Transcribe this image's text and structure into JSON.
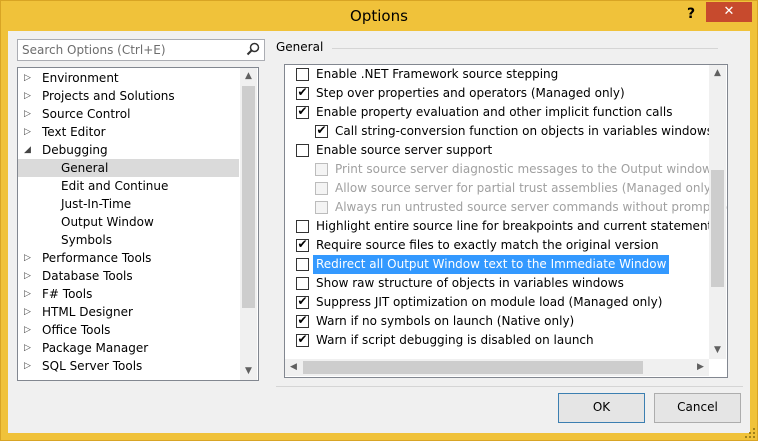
{
  "window": {
    "title": "Options",
    "help_label": "?",
    "close_label": "✕"
  },
  "search": {
    "placeholder": "Search Options (Ctrl+E)"
  },
  "tree": [
    {
      "label": "Environment",
      "level": 0,
      "expandable": true
    },
    {
      "label": "Projects and Solutions",
      "level": 0,
      "expandable": true
    },
    {
      "label": "Source Control",
      "level": 0,
      "expandable": true
    },
    {
      "label": "Text Editor",
      "level": 0,
      "expandable": true
    },
    {
      "label": "Debugging",
      "level": 0,
      "expanded": true
    },
    {
      "label": "General",
      "level": 1,
      "selected": true
    },
    {
      "label": "Edit and Continue",
      "level": 1
    },
    {
      "label": "Just-In-Time",
      "level": 1
    },
    {
      "label": "Output Window",
      "level": 1
    },
    {
      "label": "Symbols",
      "level": 1
    },
    {
      "label": "Performance Tools",
      "level": 0,
      "expandable": true
    },
    {
      "label": "Database Tools",
      "level": 0,
      "expandable": true
    },
    {
      "label": "F# Tools",
      "level": 0,
      "expandable": true
    },
    {
      "label": "HTML Designer",
      "level": 0,
      "expandable": true
    },
    {
      "label": "Office Tools",
      "level": 0,
      "expandable": true
    },
    {
      "label": "Package Manager",
      "level": 0,
      "expandable": true
    },
    {
      "label": "SQL Server Tools",
      "level": 0,
      "expandable": true
    }
  ],
  "section_title": "General",
  "options": [
    {
      "label": "Enable .NET Framework source stepping",
      "checked": false,
      "indent": 0
    },
    {
      "label": "Step over properties and operators (Managed only)",
      "checked": true,
      "indent": 0
    },
    {
      "label": "Enable property evaluation and other implicit function calls",
      "checked": true,
      "indent": 0
    },
    {
      "label": "Call string-conversion function on objects in variables windows",
      "checked": true,
      "indent": 1
    },
    {
      "label": "Enable source server support",
      "checked": false,
      "indent": 0
    },
    {
      "label": "Print source server diagnostic messages to the Output window",
      "checked": false,
      "indent": 1,
      "disabled": true
    },
    {
      "label": "Allow source server for partial trust assemblies (Managed only)",
      "checked": false,
      "indent": 1,
      "disabled": true
    },
    {
      "label": "Always run untrusted source server commands without prompting",
      "checked": false,
      "indent": 1,
      "disabled": true
    },
    {
      "label": "Highlight entire source line for breakpoints and current statement",
      "checked": false,
      "indent": 0
    },
    {
      "label": "Require source files to exactly match the original version",
      "checked": true,
      "indent": 0
    },
    {
      "label": "Redirect all Output Window text to the Immediate Window",
      "checked": false,
      "indent": 0,
      "highlighted": true
    },
    {
      "label": "Show raw structure of objects in variables windows",
      "checked": false,
      "indent": 0
    },
    {
      "label": "Suppress JIT optimization on module load (Managed only)",
      "checked": true,
      "indent": 0
    },
    {
      "label": "Warn if no symbols on launch (Native only)",
      "checked": true,
      "indent": 0
    },
    {
      "label": "Warn if script debugging is disabled on launch",
      "checked": true,
      "indent": 0
    }
  ],
  "buttons": {
    "ok": "OK",
    "cancel": "Cancel"
  }
}
